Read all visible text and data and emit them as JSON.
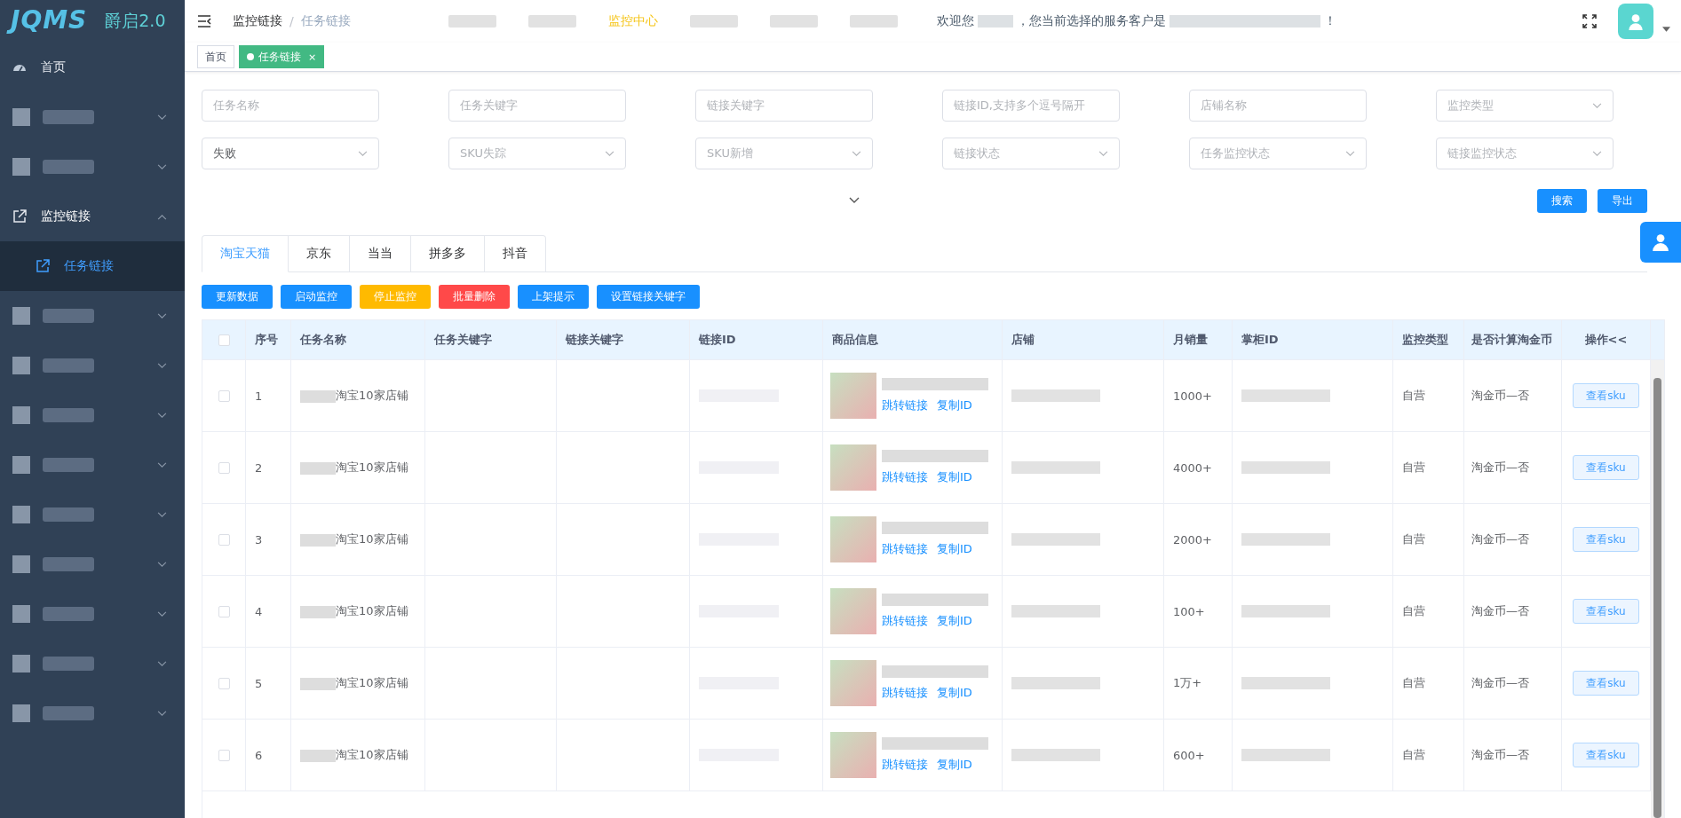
{
  "brand": {
    "logo": "JQMS",
    "name": "爵启2.0"
  },
  "sidebar": {
    "items": [
      {
        "kind": "home",
        "label": "首页"
      },
      {
        "kind": "obscured",
        "expanded": false
      },
      {
        "kind": "obscured",
        "expanded": false
      },
      {
        "kind": "link",
        "label": "监控链接",
        "expanded": true,
        "children": [
          {
            "label": "任务链接",
            "selected": true
          }
        ]
      },
      {
        "kind": "obscured",
        "expanded": false
      },
      {
        "kind": "obscured",
        "expanded": false
      },
      {
        "kind": "obscured",
        "expanded": false
      },
      {
        "kind": "obscured",
        "expanded": false
      },
      {
        "kind": "obscured",
        "expanded": false
      },
      {
        "kind": "obscured",
        "expanded": false
      },
      {
        "kind": "obscured",
        "expanded": false
      },
      {
        "kind": "obscured",
        "expanded": false
      },
      {
        "kind": "obscured",
        "expanded": false
      }
    ]
  },
  "breadcrumb": {
    "items": [
      "监控链接",
      "任务链接"
    ],
    "separator": "/"
  },
  "top_nav": [
    {
      "kind": "obscured",
      "selected": false
    },
    {
      "kind": "obscured",
      "selected": false
    },
    {
      "kind": "text",
      "label": "监控中心",
      "selected": true
    },
    {
      "kind": "obscured",
      "selected": false
    },
    {
      "kind": "obscured",
      "selected": false
    },
    {
      "kind": "obscured",
      "selected": false
    }
  ],
  "welcome": {
    "prefix": "欢迎您",
    "middle": "，您当前选择的服务客户是",
    "suffix": "！"
  },
  "tags": [
    {
      "label": "首页",
      "selected": false
    },
    {
      "label": "任务链接",
      "selected": true,
      "close": "×"
    }
  ],
  "filters": [
    {
      "kind": "input",
      "placeholder": "任务名称"
    },
    {
      "kind": "input",
      "placeholder": "任务关键字"
    },
    {
      "kind": "input",
      "placeholder": "链接关键字"
    },
    {
      "kind": "input",
      "placeholder": "链接ID,支持多个逗号隔开"
    },
    {
      "kind": "input",
      "placeholder": "店铺名称"
    },
    {
      "kind": "select",
      "placeholder": "监控类型"
    },
    {
      "kind": "select",
      "value": "失败"
    },
    {
      "kind": "select",
      "placeholder": "SKU失踪"
    },
    {
      "kind": "select",
      "placeholder": "SKU新增"
    },
    {
      "kind": "select",
      "placeholder": "链接状态"
    },
    {
      "kind": "select",
      "placeholder": "任务监控状态"
    },
    {
      "kind": "select",
      "placeholder": "链接监控状态"
    }
  ],
  "filter_buttons": [
    "搜索",
    "导出"
  ],
  "platform_tabs": [
    {
      "label": "淘宝天猫",
      "selected": true
    },
    {
      "label": "京东",
      "selected": false
    },
    {
      "label": "当当",
      "selected": false
    },
    {
      "label": "拼多多",
      "selected": false
    },
    {
      "label": "抖音",
      "selected": false
    }
  ],
  "actions": [
    {
      "label": "更新数据",
      "kind": "primary"
    },
    {
      "label": "启动监控",
      "kind": "primary"
    },
    {
      "label": "停止监控",
      "kind": "warning"
    },
    {
      "label": "批量删除",
      "kind": "danger"
    },
    {
      "label": "上架提示",
      "kind": "primary"
    },
    {
      "label": "设置链接关键字",
      "kind": "primary"
    }
  ],
  "table": {
    "select_all_checked": false,
    "columns": [
      "序号",
      "任务名称",
      "任务关键字",
      "链接关键字",
      "链接ID",
      "商品信息",
      "店铺",
      "月销量",
      "掌柜ID",
      "监控类型",
      "是否计算淘金币",
      "操作<<"
    ],
    "rows": [
      {
        "checked": false,
        "index": "1",
        "task": "淘宝10家店铺",
        "sales": "1000+",
        "monitor_type": "自营",
        "coin": "淘金币—否",
        "jump": "跳转链接",
        "copy": "复制ID",
        "action": "查看sku"
      },
      {
        "checked": false,
        "index": "2",
        "task": "淘宝10家店铺",
        "sales": "4000+",
        "monitor_type": "自营",
        "coin": "淘金币—否",
        "jump": "跳转链接",
        "copy": "复制ID",
        "action": "查看sku"
      },
      {
        "checked": false,
        "index": "3",
        "task": "淘宝10家店铺",
        "sales": "2000+",
        "monitor_type": "自营",
        "coin": "淘金币—否",
        "jump": "跳转链接",
        "copy": "复制ID",
        "action": "查看sku"
      },
      {
        "checked": false,
        "index": "4",
        "task": "淘宝10家店铺",
        "sales": "100+",
        "monitor_type": "自营",
        "coin": "淘金币—否",
        "jump": "跳转链接",
        "copy": "复制ID",
        "action": "查看sku"
      },
      {
        "checked": false,
        "index": "5",
        "task": "淘宝10家店铺",
        "sales": "1万+",
        "monitor_type": "自营",
        "coin": "淘金币—否",
        "jump": "跳转链接",
        "copy": "复制ID",
        "action": "查看sku"
      },
      {
        "checked": false,
        "index": "6",
        "task": "淘宝10家店铺",
        "sales": "600+",
        "monitor_type": "自营",
        "coin": "淘金币—否",
        "jump": "跳转链接",
        "copy": "复制ID",
        "action": "查看sku"
      }
    ]
  }
}
